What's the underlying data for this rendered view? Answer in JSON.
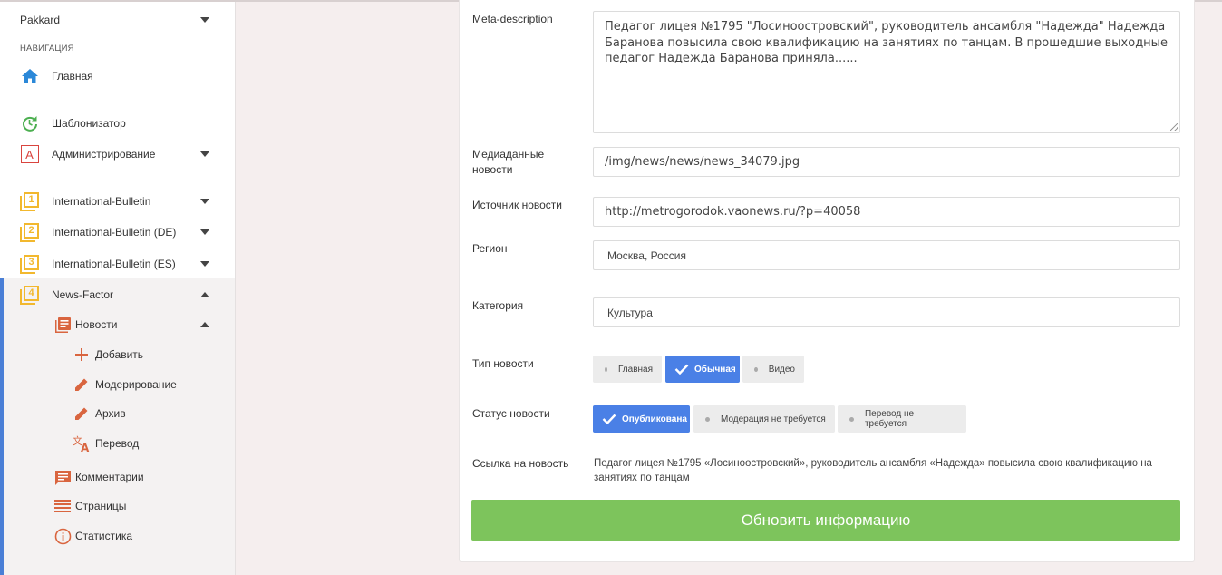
{
  "sidebar": {
    "user": "Pakkard",
    "nav_heading": "НАВИГАЦИЯ",
    "items": [
      {
        "label": "Главная"
      },
      {
        "label": "Шаблонизатор"
      },
      {
        "label": "Администрирование"
      },
      {
        "label": "International-Bulletin"
      },
      {
        "label": "International-Bulletin (DE)"
      },
      {
        "label": "International-Bulletin (ES)"
      },
      {
        "label": "News-Factor"
      }
    ],
    "icon_badges": {
      "admin": "A",
      "ib": "1",
      "ib_de": "2",
      "ib_es": "3",
      "nf": "4"
    },
    "subitems": {
      "news": "Новости",
      "add": "Добавить",
      "moderation": "Модерирование",
      "archive": "Архив",
      "translation": "Перевод",
      "comments": "Комментарии",
      "pages": "Страницы",
      "stats": "Статистика"
    }
  },
  "form": {
    "meta_description": {
      "label": "Meta-description",
      "value": "Педагог лицея №1795 \"Лосиноостровский\", руководитель ансамбля \"Надежда\" Надежда Баранова повысила свою квалификацию на занятиях по танцам. В прошедшие выходные педагог Надежда Баранова приняла......"
    },
    "media": {
      "label_line1": "Медиаданные",
      "label_line2": "новости",
      "value": "/img/news/news/news_34079.jpg"
    },
    "source": {
      "label": "Источник новости",
      "value": "http://metrogorodok.vaonews.ru/?p=40058"
    },
    "region": {
      "label": "Регион",
      "value": "Москва, Россия"
    },
    "category": {
      "label": "Категория",
      "value": "Культура"
    },
    "news_type": {
      "label": "Тип новости",
      "options": [
        "Главная",
        "Обычная",
        "Видео"
      ],
      "selected": "Обычная"
    },
    "news_status": {
      "label": "Статус новости",
      "options": [
        "Опубликована",
        "Модерация не требуется",
        "Перевод не требуется"
      ],
      "selected": "Опубликована"
    },
    "link": {
      "label": "Ссылка на новость",
      "value": "Педагог лицея №1795 «Лосиноостровский», руководитель ансамбля «Надежда» повысила свою квалификацию на занятиях по танцам"
    },
    "submit_label": "Обновить информацию"
  },
  "colors": {
    "accent": "#4a80e6",
    "submit": "#7dc45c",
    "icon_orange": "#d9653f",
    "icon_yellow": "#f2b82e",
    "icon_blue": "#2b88d8",
    "icon_green": "#4caf50"
  }
}
